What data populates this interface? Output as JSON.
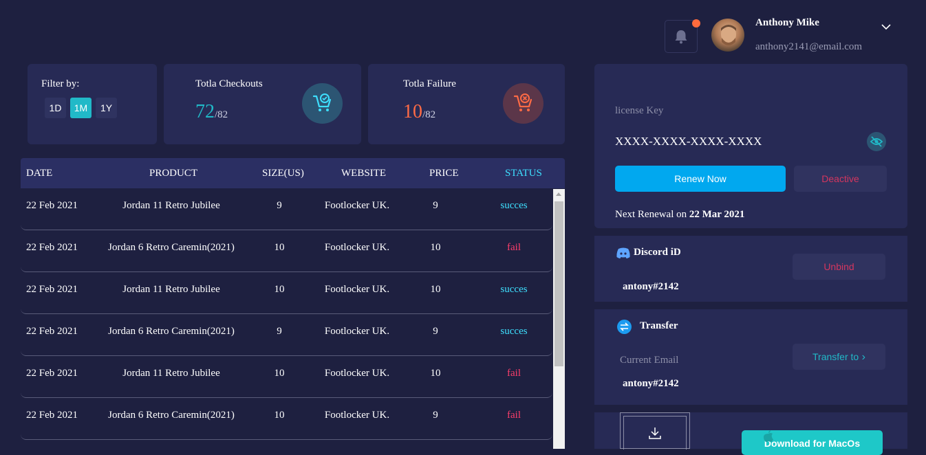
{
  "header": {
    "user_name": "Anthony Mike",
    "user_email": "anthony2141@email.com",
    "icons": {
      "bell": "bell-icon",
      "chevron": "chevron-down-icon",
      "notification_dot_color": "#ff6b3d"
    }
  },
  "filter": {
    "label": "Filter by:",
    "options": [
      "1D",
      "1M",
      "1Y"
    ],
    "selected": "1M"
  },
  "stats": {
    "checkouts": {
      "label": "Totla Checkouts",
      "value": "72",
      "total": "/82",
      "color": "#21b9c8",
      "icon": "cart-check-icon"
    },
    "failures": {
      "label": "Totla Failure",
      "value": "10",
      "total": "/82",
      "color": "#ff6b45",
      "icon": "cart-x-icon"
    }
  },
  "table": {
    "headers": [
      "DATE",
      "PRODUCT",
      "SIZE(US)",
      "WEBSITE",
      "PRICE",
      "STATUS"
    ],
    "rows": [
      [
        "22 Feb 2021",
        "Jordan 11 Retro Jubilee",
        "9",
        "Footlocker UK.",
        "9",
        "succes"
      ],
      [
        "22 Feb 2021",
        "Jordan 6 Retro Caremin(2021)",
        "10",
        "Footlocker UK.",
        "10",
        "fail"
      ],
      [
        "22 Feb 2021",
        "Jordan 11 Retro Jubilee",
        "10",
        "Footlocker UK.",
        "10",
        "succes"
      ],
      [
        "22 Feb 2021",
        "Jordan 6 Retro Caremin(2021)",
        "9",
        "Footlocker UK.",
        "9",
        "succes"
      ],
      [
        "22 Feb 2021",
        "Jordan 11 Retro Jubilee",
        "10",
        "Footlocker UK.",
        "10",
        "fail"
      ],
      [
        "22 Feb 2021",
        "Jordan 6 Retro Caremin(2021)",
        "10",
        "Footlocker UK.",
        "9",
        "fail"
      ]
    ],
    "status_colors": {
      "succes": "#3ee0ff",
      "fail": "#ff3f6c"
    }
  },
  "license": {
    "label": "license Key",
    "key": "XXXX-XXXX-XXXX-XXXX",
    "renew_button": "Renew Now",
    "deactive_button": "Deactive",
    "renewal_prefix": "Next Renewal on ",
    "renewal_date": "22 Mar 2021",
    "icon": "eye-off-icon"
  },
  "discord": {
    "label": "Discord iD",
    "value": "antony#2142",
    "unbind_button": "Unbind",
    "icon": "discord-icon"
  },
  "transfer": {
    "label": "Transfer",
    "email_label": "Current Email",
    "email_value": "antony#2142",
    "transfer_button": "Transfer to",
    "icon": "transfer-icon"
  },
  "download": {
    "button": "Download for MacOs",
    "icons": [
      "download-icon",
      "apple-icon"
    ]
  }
}
